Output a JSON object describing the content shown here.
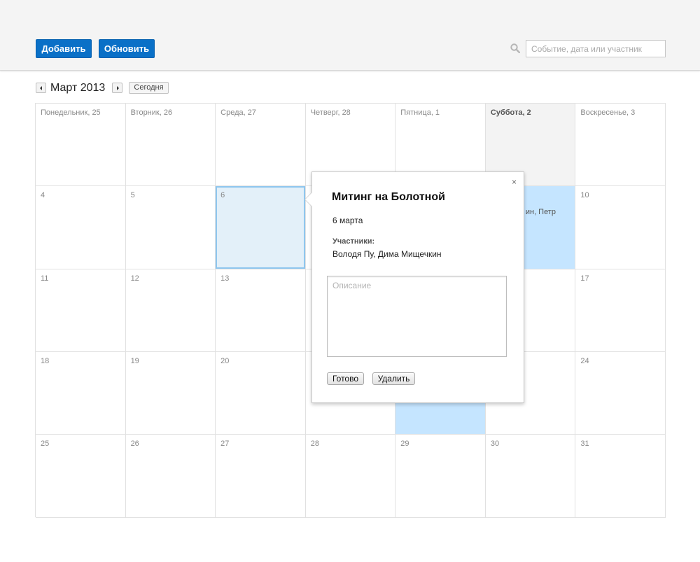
{
  "toolbar": {
    "add_label": "Добавить",
    "refresh_label": "Обновить",
    "search_placeholder": "Событие, дата или участник",
    "search_icon": "search-icon"
  },
  "nav": {
    "month_title": "Март 2013",
    "today_label": "Сегодня"
  },
  "calendar": {
    "cells": [
      {
        "label": "Понедельник, 25"
      },
      {
        "label": "Вторник, 26"
      },
      {
        "label": "Среда, 27"
      },
      {
        "label": "Четверг, 28"
      },
      {
        "label": "Пятница, 1"
      },
      {
        "label": "Суббота, 2",
        "state": "today"
      },
      {
        "label": "Воскресенье, 3"
      },
      {
        "label": "4"
      },
      {
        "label": "5"
      },
      {
        "label": "6",
        "state": "selected"
      },
      {
        "label": ""
      },
      {
        "label": ""
      },
      {
        "label": "",
        "state": "event",
        "event_title": "!",
        "event_participants": "ин, Петр"
      },
      {
        "label": "10"
      },
      {
        "label": "11"
      },
      {
        "label": "12"
      },
      {
        "label": "13"
      },
      {
        "label": ""
      },
      {
        "label": ""
      },
      {
        "label": ""
      },
      {
        "label": "17"
      },
      {
        "label": "18"
      },
      {
        "label": "19"
      },
      {
        "label": "20"
      },
      {
        "label": ""
      },
      {
        "label": "",
        "state": "event"
      },
      {
        "label": ""
      },
      {
        "label": "24"
      },
      {
        "label": "25"
      },
      {
        "label": "26"
      },
      {
        "label": "27"
      },
      {
        "label": "28"
      },
      {
        "label": "29"
      },
      {
        "label": "30"
      },
      {
        "label": "31"
      }
    ]
  },
  "popup": {
    "close_label": "×",
    "title": "Митинг на Болотной",
    "date": "6 марта",
    "participants_label": "Участники:",
    "participants": "Володя Пу, Дима Мищечкин",
    "description_placeholder": "Описание",
    "done_label": "Готово",
    "delete_label": "Удалить"
  },
  "colors": {
    "primary_button": "#0a70c7",
    "today_bg": "#f3f3f3",
    "event_bg": "#c5e5ff",
    "selected_bg": "#e3f0f9",
    "selected_border": "#8ec6ee"
  }
}
